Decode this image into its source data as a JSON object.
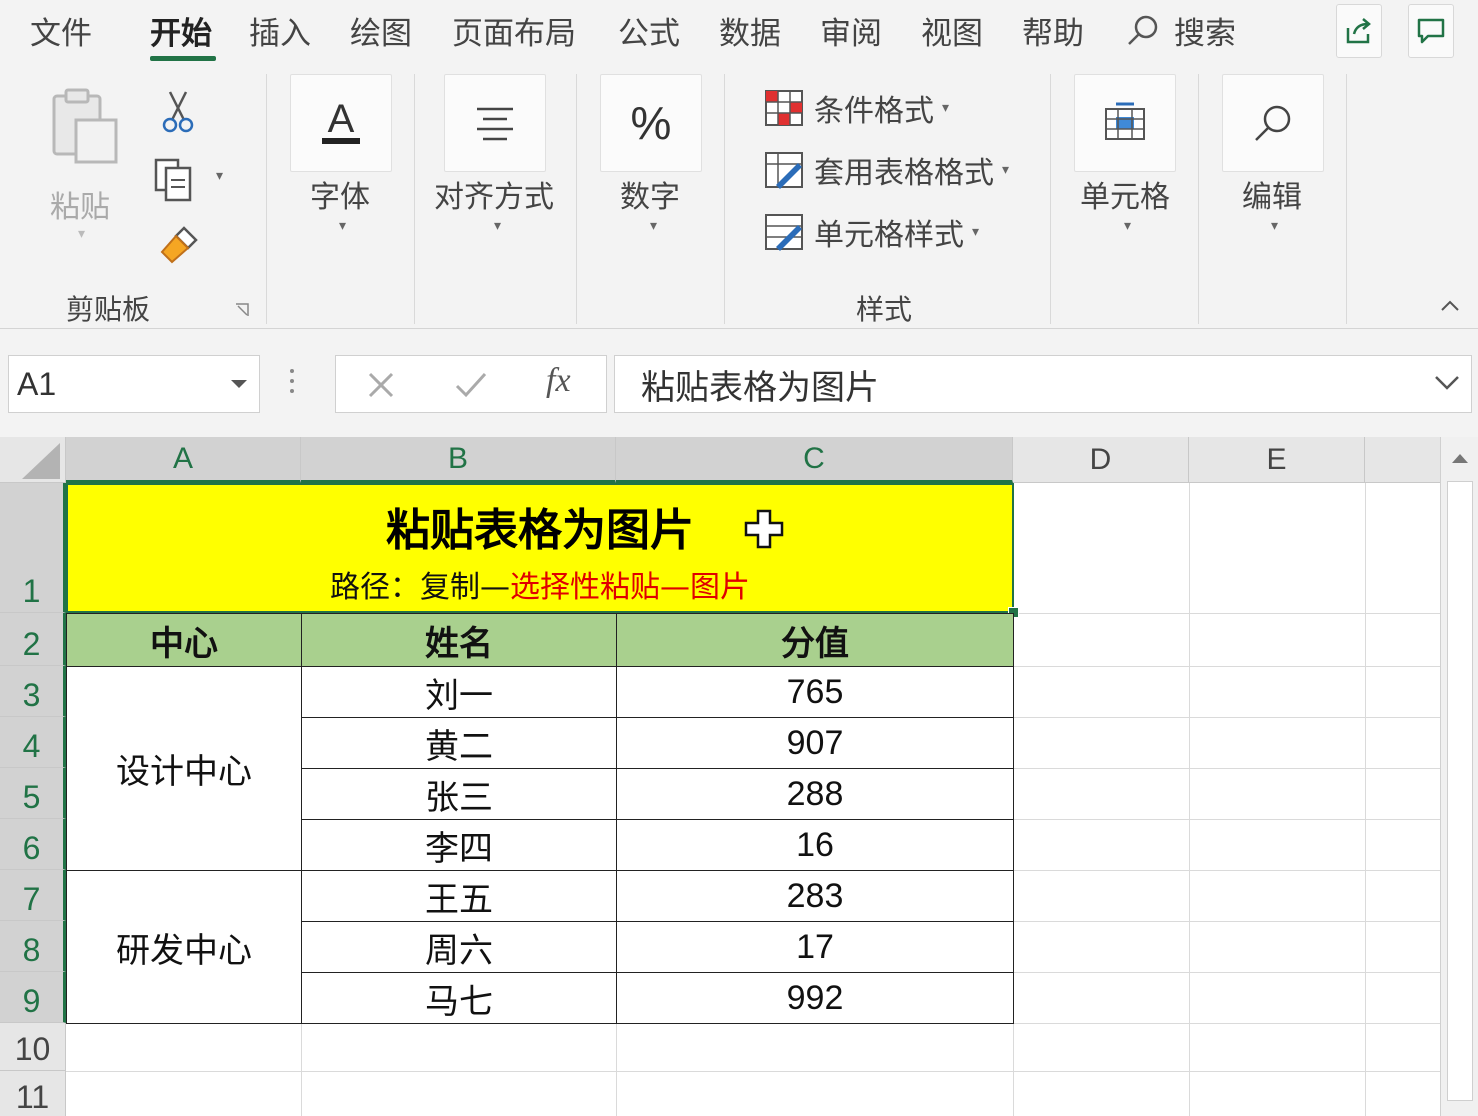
{
  "tabs": [
    "文件",
    "开始",
    "插入",
    "绘图",
    "页面布局",
    "公式",
    "数据",
    "审阅",
    "视图",
    "帮助"
  ],
  "active_tab": "开始",
  "search_label": "搜索",
  "ribbon": {
    "clipboard": {
      "paste_label": "粘贴",
      "group_label": "剪贴板"
    },
    "font_label": "字体",
    "align_label": "对齐方式",
    "number_label": "数字",
    "styles": {
      "conditional_format": "条件格式",
      "table_format": "套用表格格式",
      "cell_styles": "单元格样式",
      "group_label": "样式"
    },
    "cells_label": "单元格",
    "editing_label": "编辑"
  },
  "formula_bar": {
    "name_box": "A1",
    "formula": "粘贴表格为图片"
  },
  "columns": [
    "A",
    "B",
    "C",
    "D",
    "E"
  ],
  "rows": [
    "1",
    "2",
    "3",
    "4",
    "5",
    "6",
    "7",
    "8",
    "9",
    "10",
    "11"
  ],
  "sheet": {
    "title": "粘贴表格为图片",
    "path_prefix": "路径：复制—",
    "path_highlight": "选择性粘贴—图片",
    "headers": [
      "中心",
      "姓名",
      "分值"
    ],
    "groups": [
      {
        "center": "设计中心",
        "rows": [
          [
            "刘一",
            "765"
          ],
          [
            "黄二",
            "907"
          ],
          [
            "张三",
            "288"
          ],
          [
            "李四",
            "16"
          ]
        ]
      },
      {
        "center": "研发中心",
        "rows": [
          [
            "王五",
            "283"
          ],
          [
            "周六",
            "17"
          ],
          [
            "马七",
            "992"
          ]
        ]
      }
    ]
  },
  "colors": {
    "accent": "#217346",
    "title_fill": "#ffff00",
    "header_fill": "#a9d08e",
    "highlight_text": "#e00000"
  }
}
